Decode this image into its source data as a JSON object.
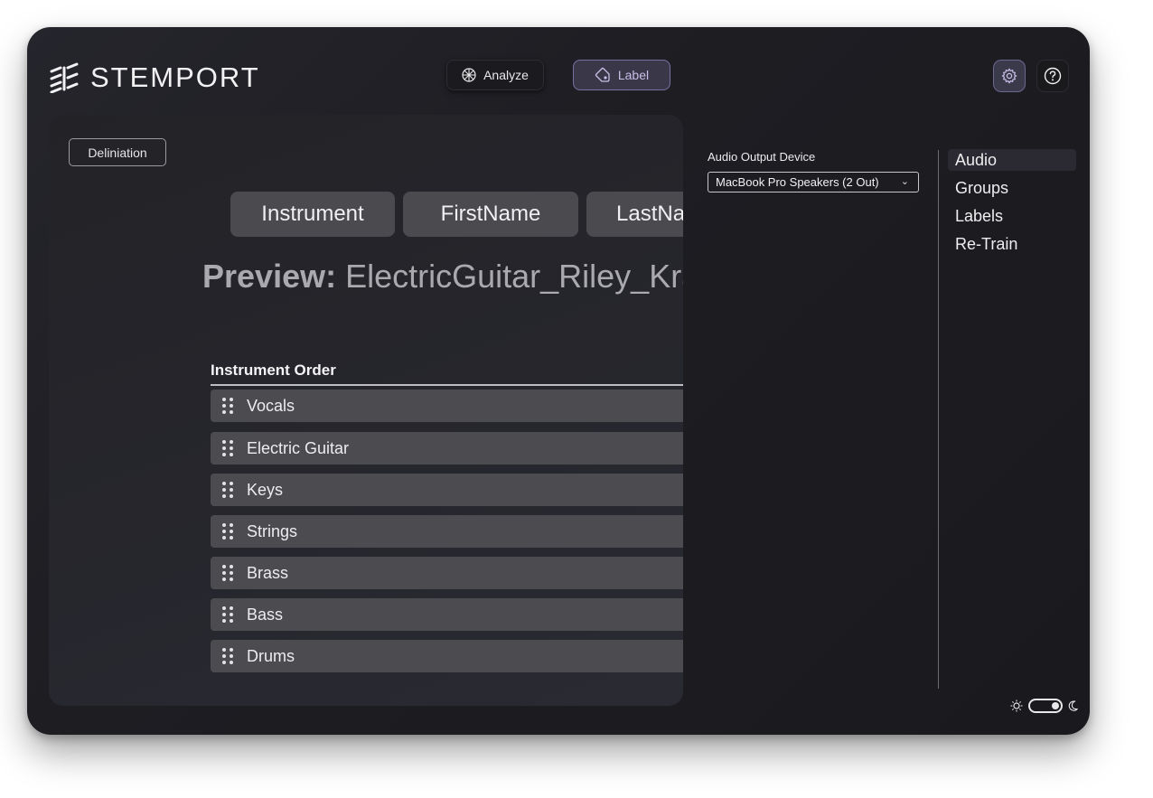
{
  "app": {
    "title": "STEMPORT"
  },
  "header": {
    "analyze_label": "Analyze",
    "label_label": "Label"
  },
  "panel": {
    "delineation_label": "Deliniation",
    "tokens": [
      "Instrument",
      "FirstName",
      "LastName"
    ],
    "preview_key": "Preview:",
    "preview_value": "ElectricGuitar_Riley_Kramer",
    "order_title": "Instrument Order",
    "instruments": [
      "Vocals",
      "Electric Guitar",
      "Keys",
      "Strings",
      "Brass",
      "Bass",
      "Drums"
    ]
  },
  "settings": {
    "output_label": "Audio Output Device",
    "output_value": "MacBook Pro Speakers (2 Out)",
    "nav": [
      "Audio",
      "Groups",
      "Labels",
      "Re-Train"
    ],
    "active_nav": "Audio"
  },
  "theme": {
    "mode": "dark"
  },
  "colors": {
    "accent": "#7a6fa3",
    "background": "#1d1d22",
    "row": "#4b4b50"
  }
}
